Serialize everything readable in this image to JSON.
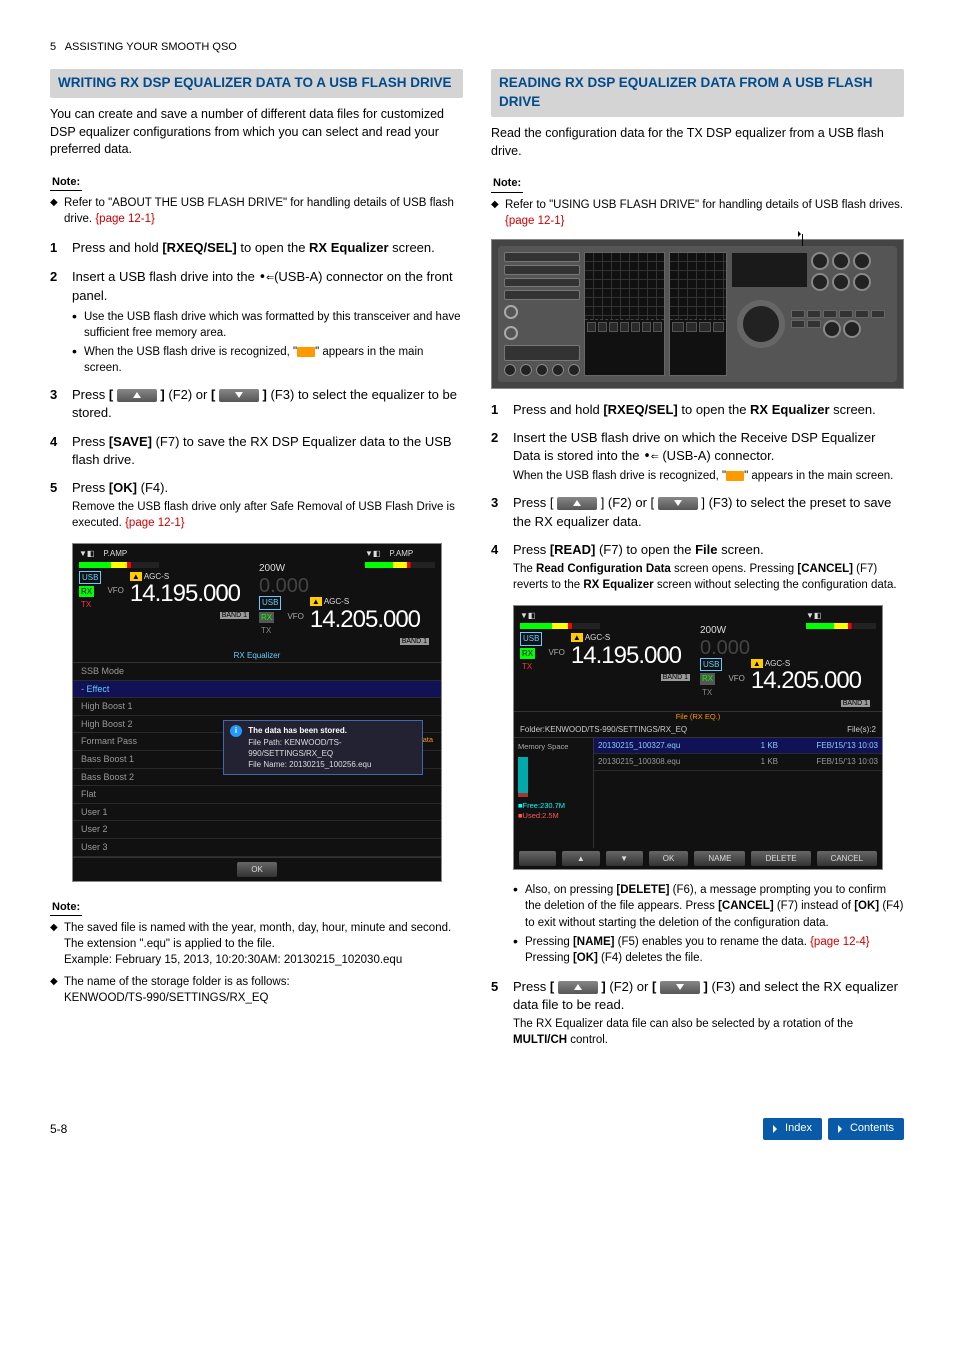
{
  "header": {
    "chapter": "5",
    "title": "ASSISTING YOUR SMOOTH QSO"
  },
  "left": {
    "section_title": "WRITING RX DSP EQUALIZER DATA TO A USB FLASH DRIVE",
    "intro": "You can create and save a number of different data files for customized DSP equalizer configurations from which you can select and read your preferred data.",
    "note_label": "Note:",
    "note1": "Refer to \"ABOUT THE USB FLASH DRIVE\" for handling details of USB flash drive.",
    "note1_link": "{page 12-1}",
    "step1_a": "Press and hold ",
    "step1_b": "[RXEQ/SEL]",
    "step1_c": " to open the ",
    "step1_d": "RX Equalizer",
    "step1_e": " screen.",
    "step2_a": "Insert a USB flash drive into the ",
    "step2_b": "(USB-A) connector on the front panel.",
    "step2_bul1": "Use the USB flash drive which was formatted by this transceiver and have sufficient free memory area.",
    "step2_bul2a": "When the USB flash drive is recognized, \"",
    "step2_bul2b": "\" appears in the main screen.",
    "step3_a": "Press ",
    "step3_b": " (F2) or ",
    "step3_c": " (F3) to select the equalizer to be stored.",
    "step4_a": "Press ",
    "step4_b": "[SAVE]",
    "step4_c": " (F7) to save the RX DSP Equalizer data to the USB flash drive.",
    "step5_a": "Press ",
    "step5_b": "[OK]",
    "step5_c": " (F4).",
    "step5_sub": "Remove the USB flash drive only after Safe Removal of USB Flash Drive is executed.  ",
    "step5_link": "{page 12-1}",
    "note2_label": "Note:",
    "note2_a": "The saved file is named with the year, month, day, hour, minute and second. The extension \".equ\" is applied to the file.",
    "note2_b": "Example: February 15, 2013, 10:20:30AM: 20130215_102030.equ",
    "note3_a": "The name of the storage folder is as follows:",
    "note3_b": "KENWOOD/TS-990/SETTINGS/RX_EQ",
    "screenshot1": {
      "pamp": "P.AMP",
      "pow": "200W",
      "zero": "0.000",
      "usb": "USB",
      "rx": "RX",
      "tx": "TX",
      "vfo": "VFO",
      "agc_warn": "▲",
      "agc": "AGC-S",
      "freqA": "14.195.000",
      "freqB": "14.205.000",
      "band": "BAND 1",
      "title": "RX Equalizer",
      "items": [
        "SSB Mode",
        " - Effect",
        "High Boost 1",
        "High Boost 2",
        "Formant Pass",
        "Bass Boost 1",
        "Bass Boost 2",
        "Flat",
        "User 1",
        "User 2",
        "User 3"
      ],
      "saving": "Saving the Data",
      "dlg1": "The data has been stored.",
      "dlg2": "File Path: KENWOOD/TS-990/SETTINGS/RX_EQ",
      "dlg3": "File Name: 20130215_100256.equ",
      "ok": "OK"
    }
  },
  "right": {
    "section_title": "READING RX DSP EQUALIZER DATA FROM A USB FLASH DRIVE",
    "intro": "Read the configuration data for the TX DSP equalizer from a USB flash drive.",
    "note_label": "Note:",
    "note1": "Refer to \"USING USB FLASH DRIVE\" for handling details of USB flash drives.",
    "note1_link": "{page 12-1}",
    "step1_a": "Press and hold ",
    "step1_b": "[RXEQ/SEL]",
    "step1_c": " to open the ",
    "step1_d": "RX Equalizer",
    "step1_e": " screen.",
    "step2_a": "Insert the USB flash drive on which the Receive DSP Equalizer Data is stored into the ",
    "step2_b": " (USB-A) connector.",
    "step2_sub_a": "When the USB flash drive is recognized, \"",
    "step2_sub_b": "\" appears in the main screen.",
    "step3_a": "Press [ ",
    "step3_b": " ] (F2) or [ ",
    "step3_c": " ] (F3) to select the preset to save the RX equalizer data.",
    "step4_a": "Press ",
    "step4_b": "[READ]",
    "step4_c": " (F7) to open the ",
    "step4_d": "File",
    "step4_e": " screen.",
    "step4_sub_a": "The ",
    "step4_sub_b": "Read Configuration Data",
    "step4_sub_c": " screen opens. Pressing ",
    "step4_sub_d": "[CANCEL]",
    "step4_sub_e": " (F7) reverts to the ",
    "step4_sub_f": "RX Equalizer",
    "step4_sub_g": " screen without selecting the configuration data.",
    "bul_a1": "Also, on pressing ",
    "bul_a2": "[DELETE]",
    "bul_a3": " (F6), a message prompting you to confirm the deletion of the file appears. Press ",
    "bul_a4": "[CANCEL]",
    "bul_a5": " (F7) instead of ",
    "bul_a6": "[OK]",
    "bul_a7": " (F4) to exit without starting the deletion of the configuration data.",
    "bul_b1": "Pressing ",
    "bul_b2": "[NAME]",
    "bul_b3": " (F5) enables you to rename the data. ",
    "bul_b_link": "{page 12-4}",
    "bul_b4": " Pressing ",
    "bul_b5": "[OK]",
    "bul_b6": " (F4) deletes the file.",
    "step5_a": "Press ",
    "step5_b": " (F2) or ",
    "step5_c": " (F3) and select the RX equalizer data file to be read.",
    "step5_sub_a": "The RX Equalizer data file can also be selected by a rotation of the ",
    "step5_sub_b": "MULTI/CH",
    "step5_sub_c": " control.",
    "screenshot2": {
      "pamp": "P.AMP",
      "pow": "200W",
      "zero": "0.000",
      "usb": "USB",
      "rx": "RX",
      "tx": "TX",
      "vfo": "VFO",
      "agc": "AGC-S",
      "freqA": "14.195.000",
      "freqB": "14.205.000",
      "band": "BAND 1",
      "file_title": "File (RX EQ.)",
      "folder": "Folder:KENWOOD/TS-990/SETTINGS/RX_EQ",
      "files_count": "File(s):2",
      "memspace": "Memory Space",
      "row1_fn": "20130215_100327.equ",
      "row1_sz": "1 KB",
      "row1_dt": "FEB/15/'13 10:03",
      "row2_fn": "20130215_100308.equ",
      "row2_sz": "1 KB",
      "row2_dt": "FEB/15/'13 10:03",
      "free": "Free:230.7M",
      "used": "Used:2.5M",
      "btns": [
        "",
        "▲",
        "▼",
        "OK",
        "NAME",
        "DELETE",
        "CANCEL"
      ]
    }
  },
  "footer": {
    "page": "5-8",
    "index": "Index",
    "contents": "Contents"
  }
}
